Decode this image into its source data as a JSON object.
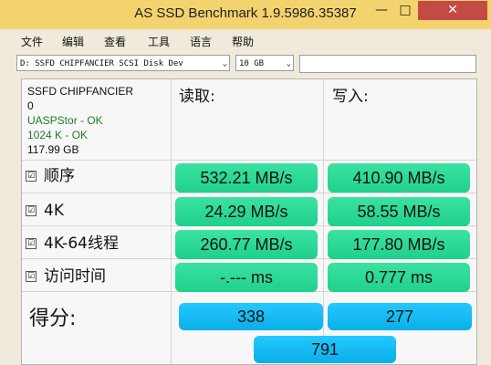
{
  "window": {
    "title": "AS SSD Benchmark 1.9.5986.35387",
    "minimize": "—",
    "maximize": "□",
    "close": "✕"
  },
  "menu": [
    "文件",
    "编辑",
    "查看",
    "工具",
    "语言",
    "帮助"
  ],
  "toolbar": {
    "drive": "D: SSFD CHIPFANCIER SCSI Disk Dev",
    "size": "10 GB",
    "arrow": "⌄"
  },
  "drive_info": {
    "name": "SSFD CHIPFANCIER",
    "number": "0",
    "driver": "UASPStor - OK",
    "alignment": "1024 K - OK",
    "capacity": "117.99 GB"
  },
  "columns": {
    "read": "读取:",
    "write": "写入:"
  },
  "rows": [
    {
      "label": "顺序",
      "checked": "☑",
      "read": "532.21 MB/s",
      "write": "410.90 MB/s"
    },
    {
      "label": "4K",
      "checked": "☑",
      "read": "24.29 MB/s",
      "write": "58.55 MB/s"
    },
    {
      "label": "4K-64线程",
      "checked": "☑",
      "read": "260.77 MB/s",
      "write": "177.80 MB/s"
    },
    {
      "label": "访问时间",
      "checked": "☑",
      "read": "-.--- ms",
      "write": "0.777 ms"
    }
  ],
  "score": {
    "label": "得分:",
    "read": "338",
    "write": "277",
    "total": "791"
  }
}
